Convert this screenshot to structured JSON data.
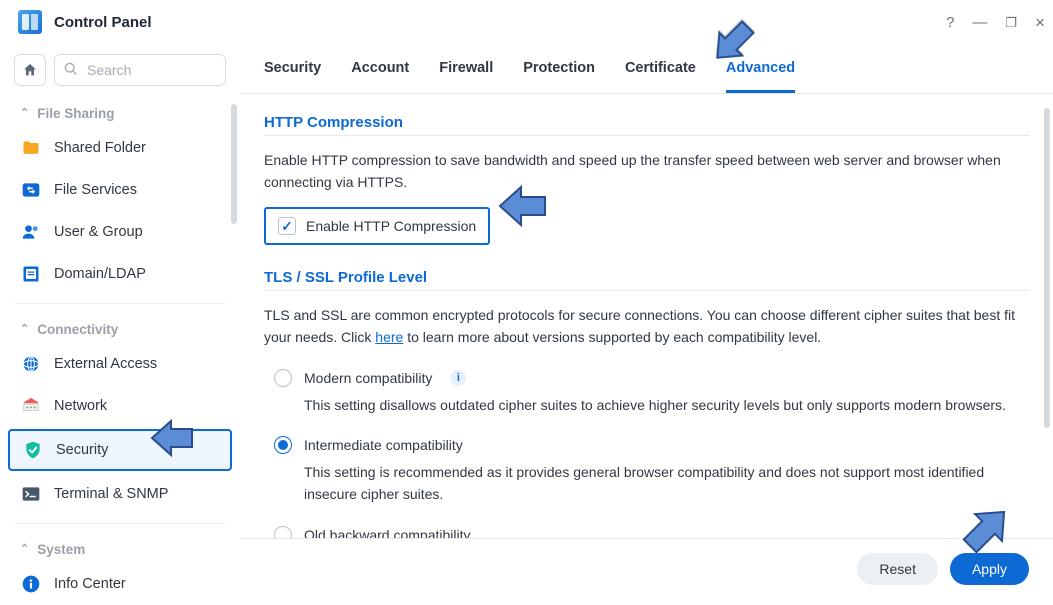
{
  "window": {
    "title": "Control Panel"
  },
  "sidebar": {
    "search_placeholder": "Search",
    "groups": [
      {
        "id": "file-sharing",
        "label": "File Sharing",
        "items": [
          {
            "id": "shared-folder",
            "label": "Shared Folder",
            "icon": "folder",
            "color": "#f5a623"
          },
          {
            "id": "file-services",
            "label": "File Services",
            "icon": "arrows",
            "color": "#0d6ad5"
          },
          {
            "id": "user-group",
            "label": "User & Group",
            "icon": "user",
            "color": "#0d6ad5"
          },
          {
            "id": "domain-ldap",
            "label": "Domain/LDAP",
            "icon": "book",
            "color": "#0d6ad5"
          }
        ]
      },
      {
        "id": "connectivity",
        "label": "Connectivity",
        "items": [
          {
            "id": "external-access",
            "label": "External Access",
            "icon": "globe",
            "color": "#0d6ad5"
          },
          {
            "id": "network",
            "label": "Network",
            "icon": "net",
            "color": "#0d6ad5"
          },
          {
            "id": "security",
            "label": "Security",
            "icon": "shield",
            "color": "#0fbfa0",
            "active": true,
            "highlight": true
          },
          {
            "id": "terminal-snmp",
            "label": "Terminal & SNMP",
            "icon": "terminal",
            "color": "#49586b"
          }
        ]
      },
      {
        "id": "system",
        "label": "System",
        "items": [
          {
            "id": "info-center",
            "label": "Info Center",
            "icon": "info",
            "color": "#0d6ad5"
          }
        ]
      }
    ]
  },
  "tabs": [
    {
      "id": "security",
      "label": "Security"
    },
    {
      "id": "account",
      "label": "Account"
    },
    {
      "id": "firewall",
      "label": "Firewall"
    },
    {
      "id": "protection",
      "label": "Protection"
    },
    {
      "id": "certificate",
      "label": "Certificate"
    },
    {
      "id": "advanced",
      "label": "Advanced",
      "active": true
    }
  ],
  "sections": {
    "http_compression": {
      "title": "HTTP Compression",
      "desc": "Enable HTTP compression to save bandwidth and speed up the transfer speed between web server and browser when connecting via HTTPS.",
      "checkbox_label": "Enable HTTP Compression",
      "checked": true
    },
    "tls": {
      "title": "TLS / SSL Profile Level",
      "desc_pre": "TLS and SSL are common encrypted protocols for secure connections. You can choose different cipher suites that best fit your needs. Click ",
      "desc_link": "here",
      "desc_post": " to learn more about versions supported by each compatibility level.",
      "options": [
        {
          "id": "modern",
          "label": "Modern compatibility",
          "info": true,
          "desc": "This setting disallows outdated cipher suites to achieve higher security levels but only supports modern browsers."
        },
        {
          "id": "intermediate",
          "label": "Intermediate compatibility",
          "selected": true,
          "desc": "This setting is recommended as it provides general browser compatibility and does not support most identified insecure cipher suites."
        },
        {
          "id": "old",
          "label": "Old backward compatibility"
        }
      ]
    }
  },
  "footer": {
    "reset": "Reset",
    "apply": "Apply"
  }
}
